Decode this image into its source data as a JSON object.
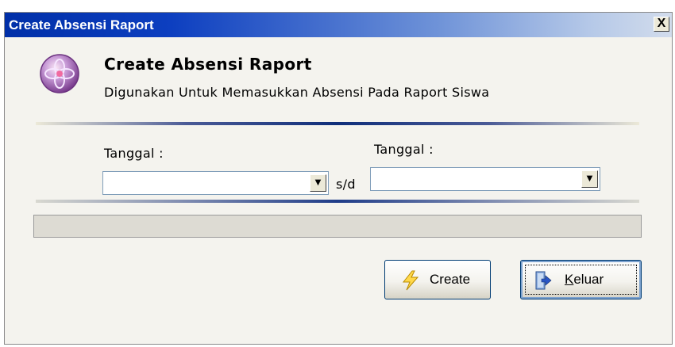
{
  "window": {
    "title": "Create Absensi Raport",
    "close_label": "X"
  },
  "header": {
    "title": "Create Absensi Raport",
    "subtitle": "Digunakan Untuk Memasukkan Absensi Pada Raport Siswa",
    "icon": "purple-flower-orb-icon"
  },
  "form": {
    "start_label": "Tanggal :",
    "start_value": "",
    "separator": "s/d",
    "end_label": "Tanggal :",
    "end_value": ""
  },
  "progress": {
    "value": 0
  },
  "buttons": {
    "create_label": "Create",
    "create_icon": "lightning-icon",
    "keluar_label_first": "K",
    "keluar_label_rest": "eluar",
    "keluar_icon": "exit-door-icon"
  },
  "colors": {
    "titlebar_start": "#002fa8",
    "titlebar_end": "#d2dcec",
    "window_bg": "#f4f3ee",
    "divider": "#0f2e7a",
    "button_border": "#003c74"
  }
}
